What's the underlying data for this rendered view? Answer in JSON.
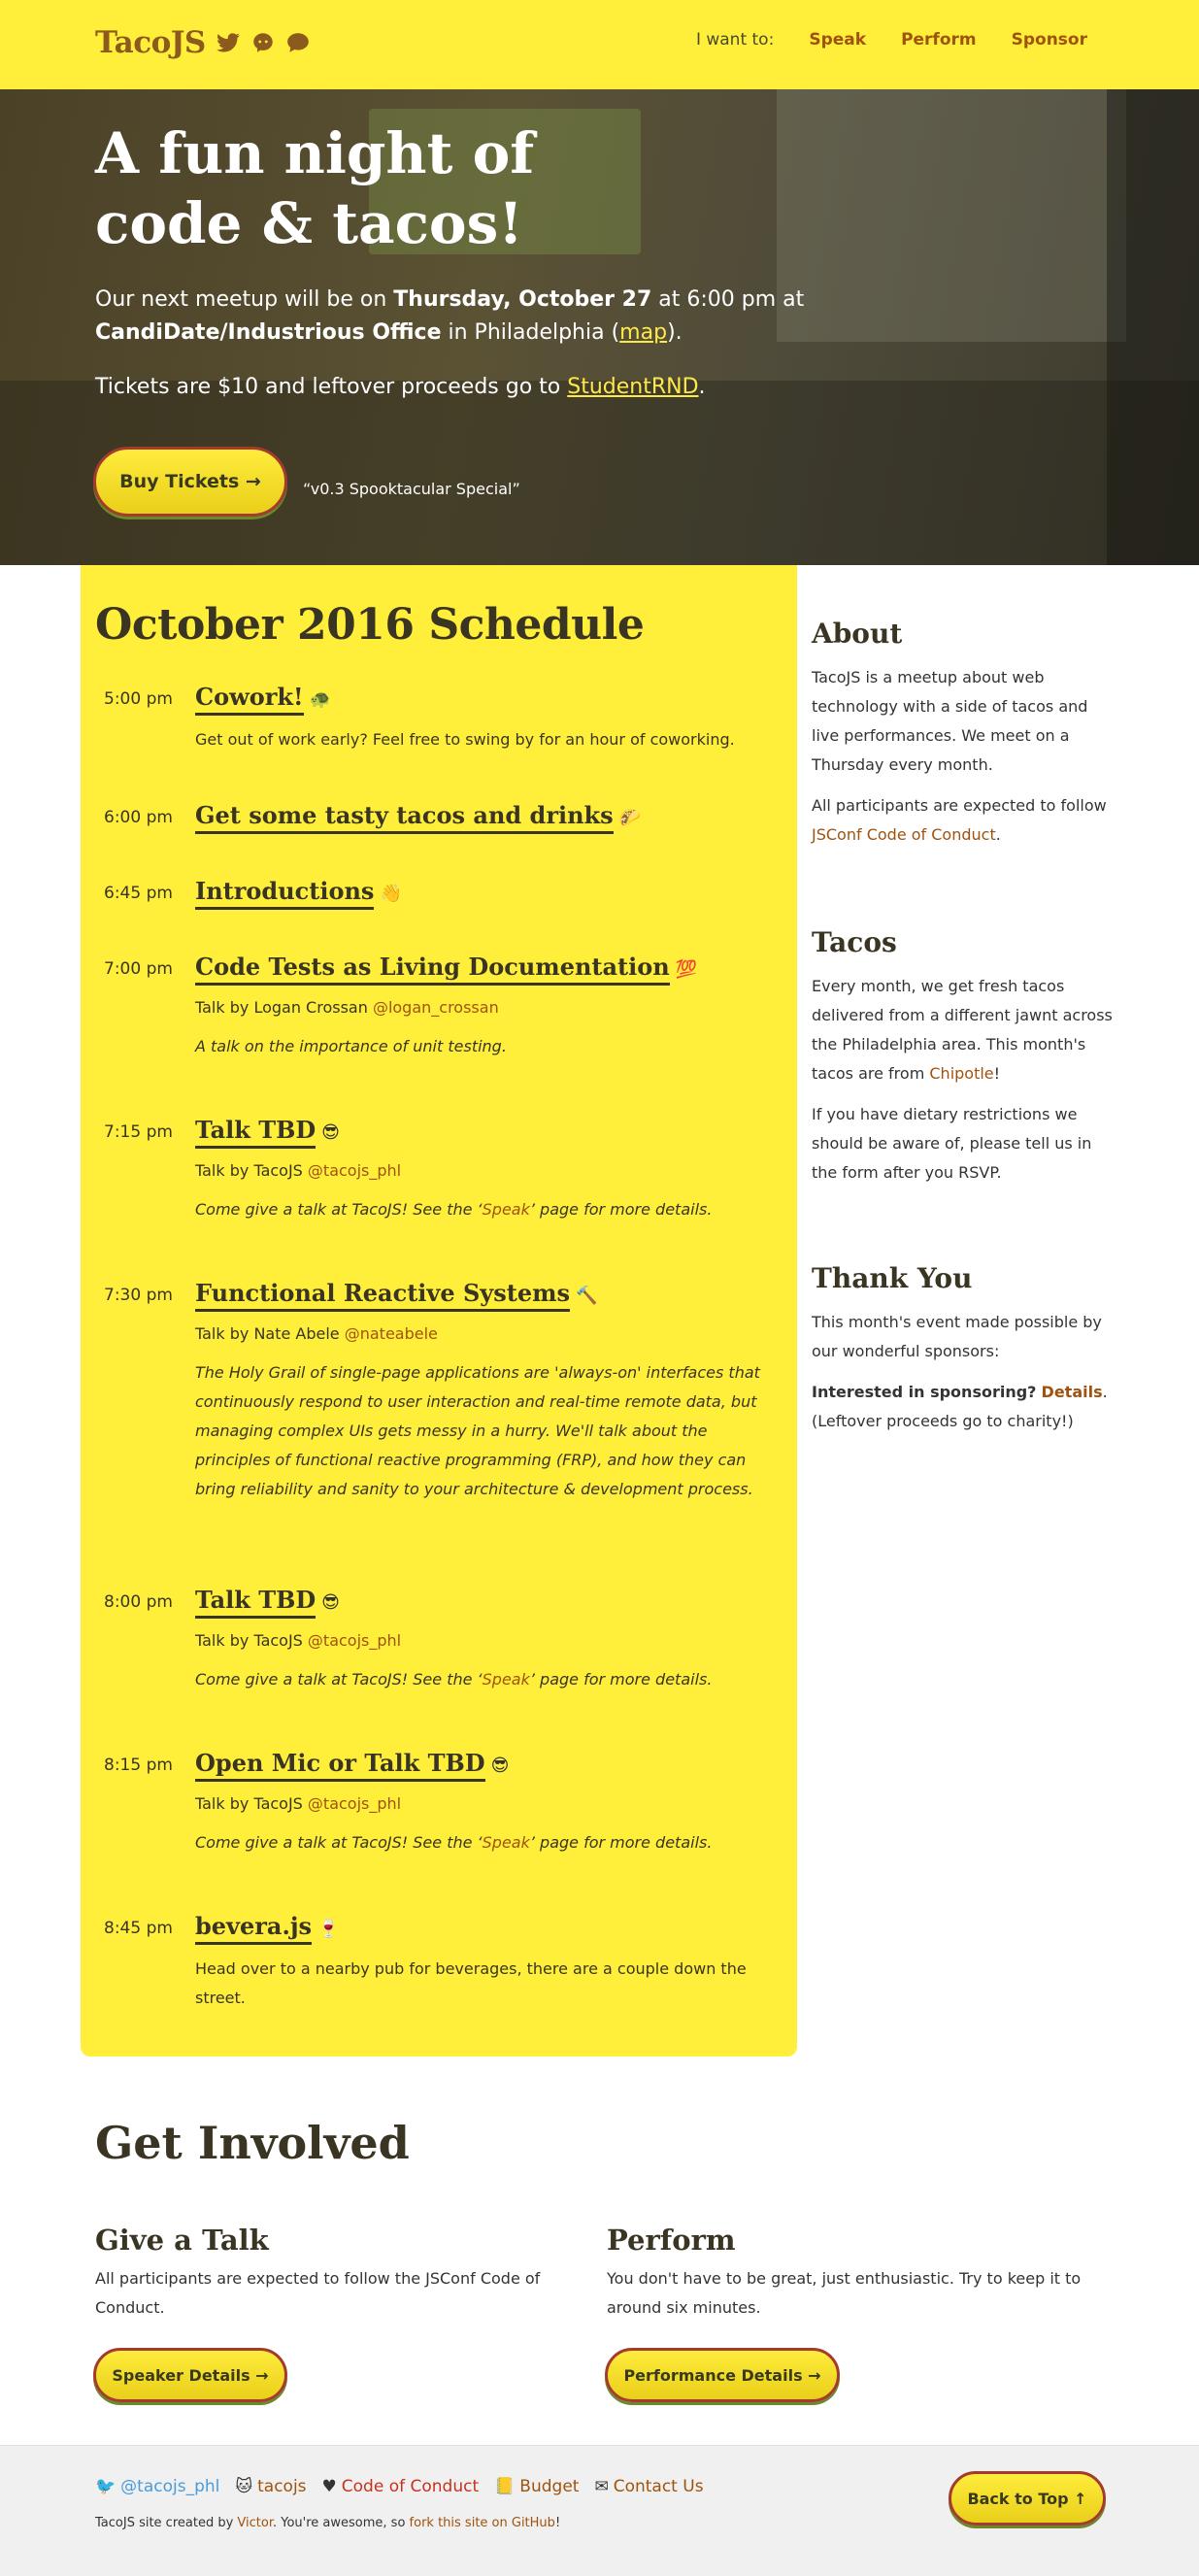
{
  "header": {
    "brand": "TacoJS",
    "nav_label": "I want to:",
    "nav_links": [
      "Speak",
      "Perform",
      "Sponsor"
    ]
  },
  "hero": {
    "title_line1": "A fun night of",
    "title_line2": "code & tacos!",
    "p1_pre": "Our next meetup will be on ",
    "p1_date": "Thursday, October 27",
    "p1_mid": " at 6:00 pm at ",
    "p1_venue": "CandiDate/Industrious Office",
    "p1_post": " in Philadelphia (",
    "p1_map": "map",
    "p1_end": ").",
    "p2_pre": "Tickets are $10 and leftover proceeds go to ",
    "p2_link": "StudentRND",
    "p2_end": ".",
    "button": "Buy Tickets →",
    "tagline": "“v0.3 Spooktacular Special”"
  },
  "schedule": {
    "title": "October 2016 Schedule",
    "events": [
      {
        "time": "5:00 pm",
        "title": "Cowork!",
        "emoji": "🐢",
        "text": "Get out of work early? Feel free to swing by for an hour of coworking."
      },
      {
        "time": "6:00 pm",
        "title": "Get some tasty tacos and drinks",
        "emoji": "🌮"
      },
      {
        "time": "6:45 pm",
        "title": "Introductions",
        "emoji": "👋"
      },
      {
        "time": "7:00 pm",
        "title": "Code Tests as Living Documentation",
        "emoji": "💯",
        "speaker": "Talk by Logan Crossan ",
        "handle": "@logan_crossan",
        "desc": "A talk on the importance of unit testing."
      },
      {
        "time": "7:15 pm",
        "title": "Talk TBD",
        "emoji": "😎",
        "speaker": "Talk by TacoJS ",
        "handle": "@tacojs_phl",
        "desc_pre": "Come give a talk at TacoJS! See the ‘",
        "desc_link": "Speak",
        "desc_post": "’ page for more details."
      },
      {
        "time": "7:30 pm",
        "title": "Functional Reactive Systems",
        "emoji": "🔨",
        "speaker": "Talk by Nate Abele ",
        "handle": "@nateabele",
        "desc": "The Holy Grail of single-page applications are 'always-on' interfaces that continuously respond to user interaction and real-time remote data, but managing complex UIs gets messy in a hurry. We'll talk about the principles of functional reactive programming (FRP), and how they can bring reliability and sanity to your architecture & development process."
      },
      {
        "time": "8:00 pm",
        "title": "Talk TBD",
        "emoji": "😎",
        "speaker": "Talk by TacoJS ",
        "handle": "@tacojs_phl",
        "desc_pre": "Come give a talk at TacoJS! See the ‘",
        "desc_link": "Speak",
        "desc_post": "’ page for more details."
      },
      {
        "time": "8:15 pm",
        "title": "Open Mic or Talk TBD",
        "emoji": "😎",
        "speaker": "Talk by TacoJS ",
        "handle": "@tacojs_phl",
        "desc_pre": "Come give a talk at TacoJS! See the ‘",
        "desc_link": "Speak",
        "desc_post": "’ page for more details."
      },
      {
        "time": "8:45 pm",
        "title": "bevera.js",
        "emoji": "🍷",
        "text": "Head over to a nearby pub for beverages, there are a couple down the street."
      }
    ]
  },
  "sidebar": {
    "about_title": "About",
    "about_p1": "TacoJS is a meetup about web technology with a side of tacos and live performances. We meet on a Thursday every month.",
    "about_p2_pre": "All participants are expected to follow ",
    "about_p2_link": "JSConf Code of Conduct",
    "about_p2_end": ".",
    "tacos_title": "Tacos",
    "tacos_p1_pre": "Every month, we get fresh tacos delivered from a different jawnt across the Philadelphia area. This month's tacos are from ",
    "tacos_p1_link": "Chipotle",
    "tacos_p1_end": "!",
    "tacos_p2": "If you have dietary restrictions we should be aware of, please tell us in the form after you RSVP.",
    "thanks_title": "Thank You",
    "thanks_p1": "This month's event made possible by our wonderful sponsors:",
    "thanks_p2_bold": "Interested in sponsoring?",
    "thanks_p2_link": "Details",
    "thanks_p2_end": ".",
    "thanks_p3": "(Leftover proceeds go to charity!)"
  },
  "involved": {
    "title": "Get Involved",
    "talk_title": "Give a Talk",
    "talk_text": "All participants are expected to follow the JSConf Code of Conduct.",
    "talk_button": "Speaker Details →",
    "perform_title": "Perform",
    "perform_text": "You don't have to be great, just enthusiastic. Try to keep it to around six minutes.",
    "perform_button": "Performance Details →"
  },
  "footer": {
    "twitter": "@tacojs_phl",
    "github": "tacojs",
    "coc": "Code of Conduct",
    "budget": "Budget",
    "contact": "Contact Us",
    "credit_pre": "TacoJS site created by ",
    "credit_author": "Victor",
    "credit_mid": ". You're awesome, so ",
    "credit_fork": "fork this site on GitHub",
    "credit_end": "!",
    "back_to_top": "Back to Top ↑"
  },
  "colors": {
    "yellow": "#ffef3a",
    "brand_brown": "#8b5a1c",
    "link_orange": "#a0520f",
    "button_border": "#a33b2e"
  }
}
